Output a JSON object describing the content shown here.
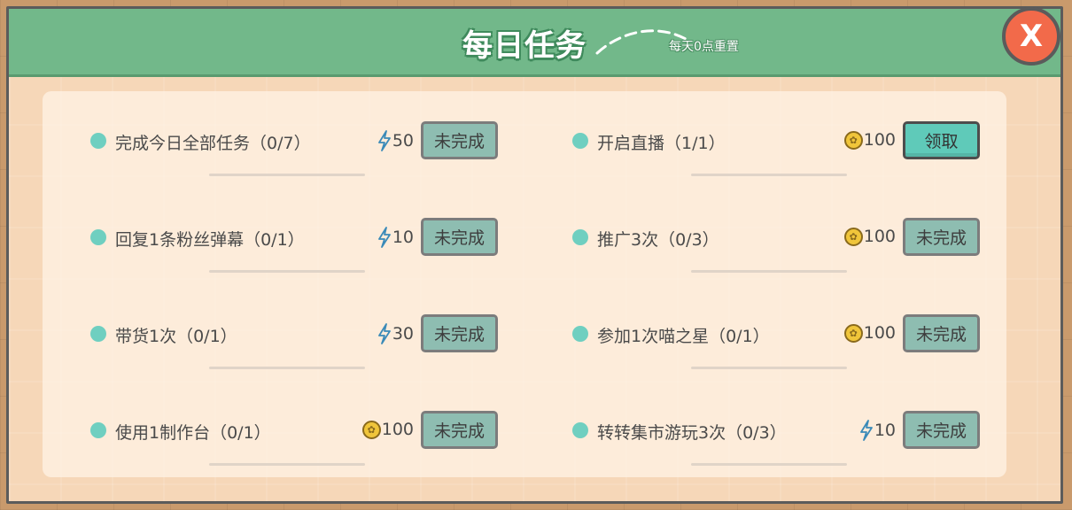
{
  "panel": {
    "title": "每日任务",
    "reset_note": "每天0点重置",
    "close_label": "X"
  },
  "colors": {
    "header_green": "#72b88a",
    "panel_bg": "#f6d7b8",
    "dot_teal": "#6fcfc0",
    "button_incomplete": "#8ebdb1",
    "button_claim": "#5fcab9",
    "close_red": "#f26a4a"
  },
  "tasks": [
    {
      "label": "完成今日全部任务（0/7）",
      "reward_icon": "energy-bolt-icon",
      "reward": "50",
      "status": "未完成",
      "claimable": false
    },
    {
      "label": "开启直播（1/1）",
      "reward_icon": "coin-icon",
      "reward": "100",
      "status": "领取",
      "claimable": true
    },
    {
      "label": "回复1条粉丝弹幕（0/1）",
      "reward_icon": "energy-bolt-icon",
      "reward": "10",
      "status": "未完成",
      "claimable": false
    },
    {
      "label": "推广3次（0/3）",
      "reward_icon": "coin-icon",
      "reward": "100",
      "status": "未完成",
      "claimable": false
    },
    {
      "label": "带货1次（0/1）",
      "reward_icon": "energy-bolt-icon",
      "reward": "30",
      "status": "未完成",
      "claimable": false
    },
    {
      "label": "参加1次喵之星（0/1）",
      "reward_icon": "coin-icon",
      "reward": "100",
      "status": "未完成",
      "claimable": false
    },
    {
      "label": "使用1制作台（0/1）",
      "reward_icon": "coin-icon",
      "reward": "100",
      "status": "未完成",
      "claimable": false
    },
    {
      "label": "转转集市游玩3次（0/3）",
      "reward_icon": "energy-bolt-icon",
      "reward": "10",
      "status": "未完成",
      "claimable": false
    }
  ]
}
